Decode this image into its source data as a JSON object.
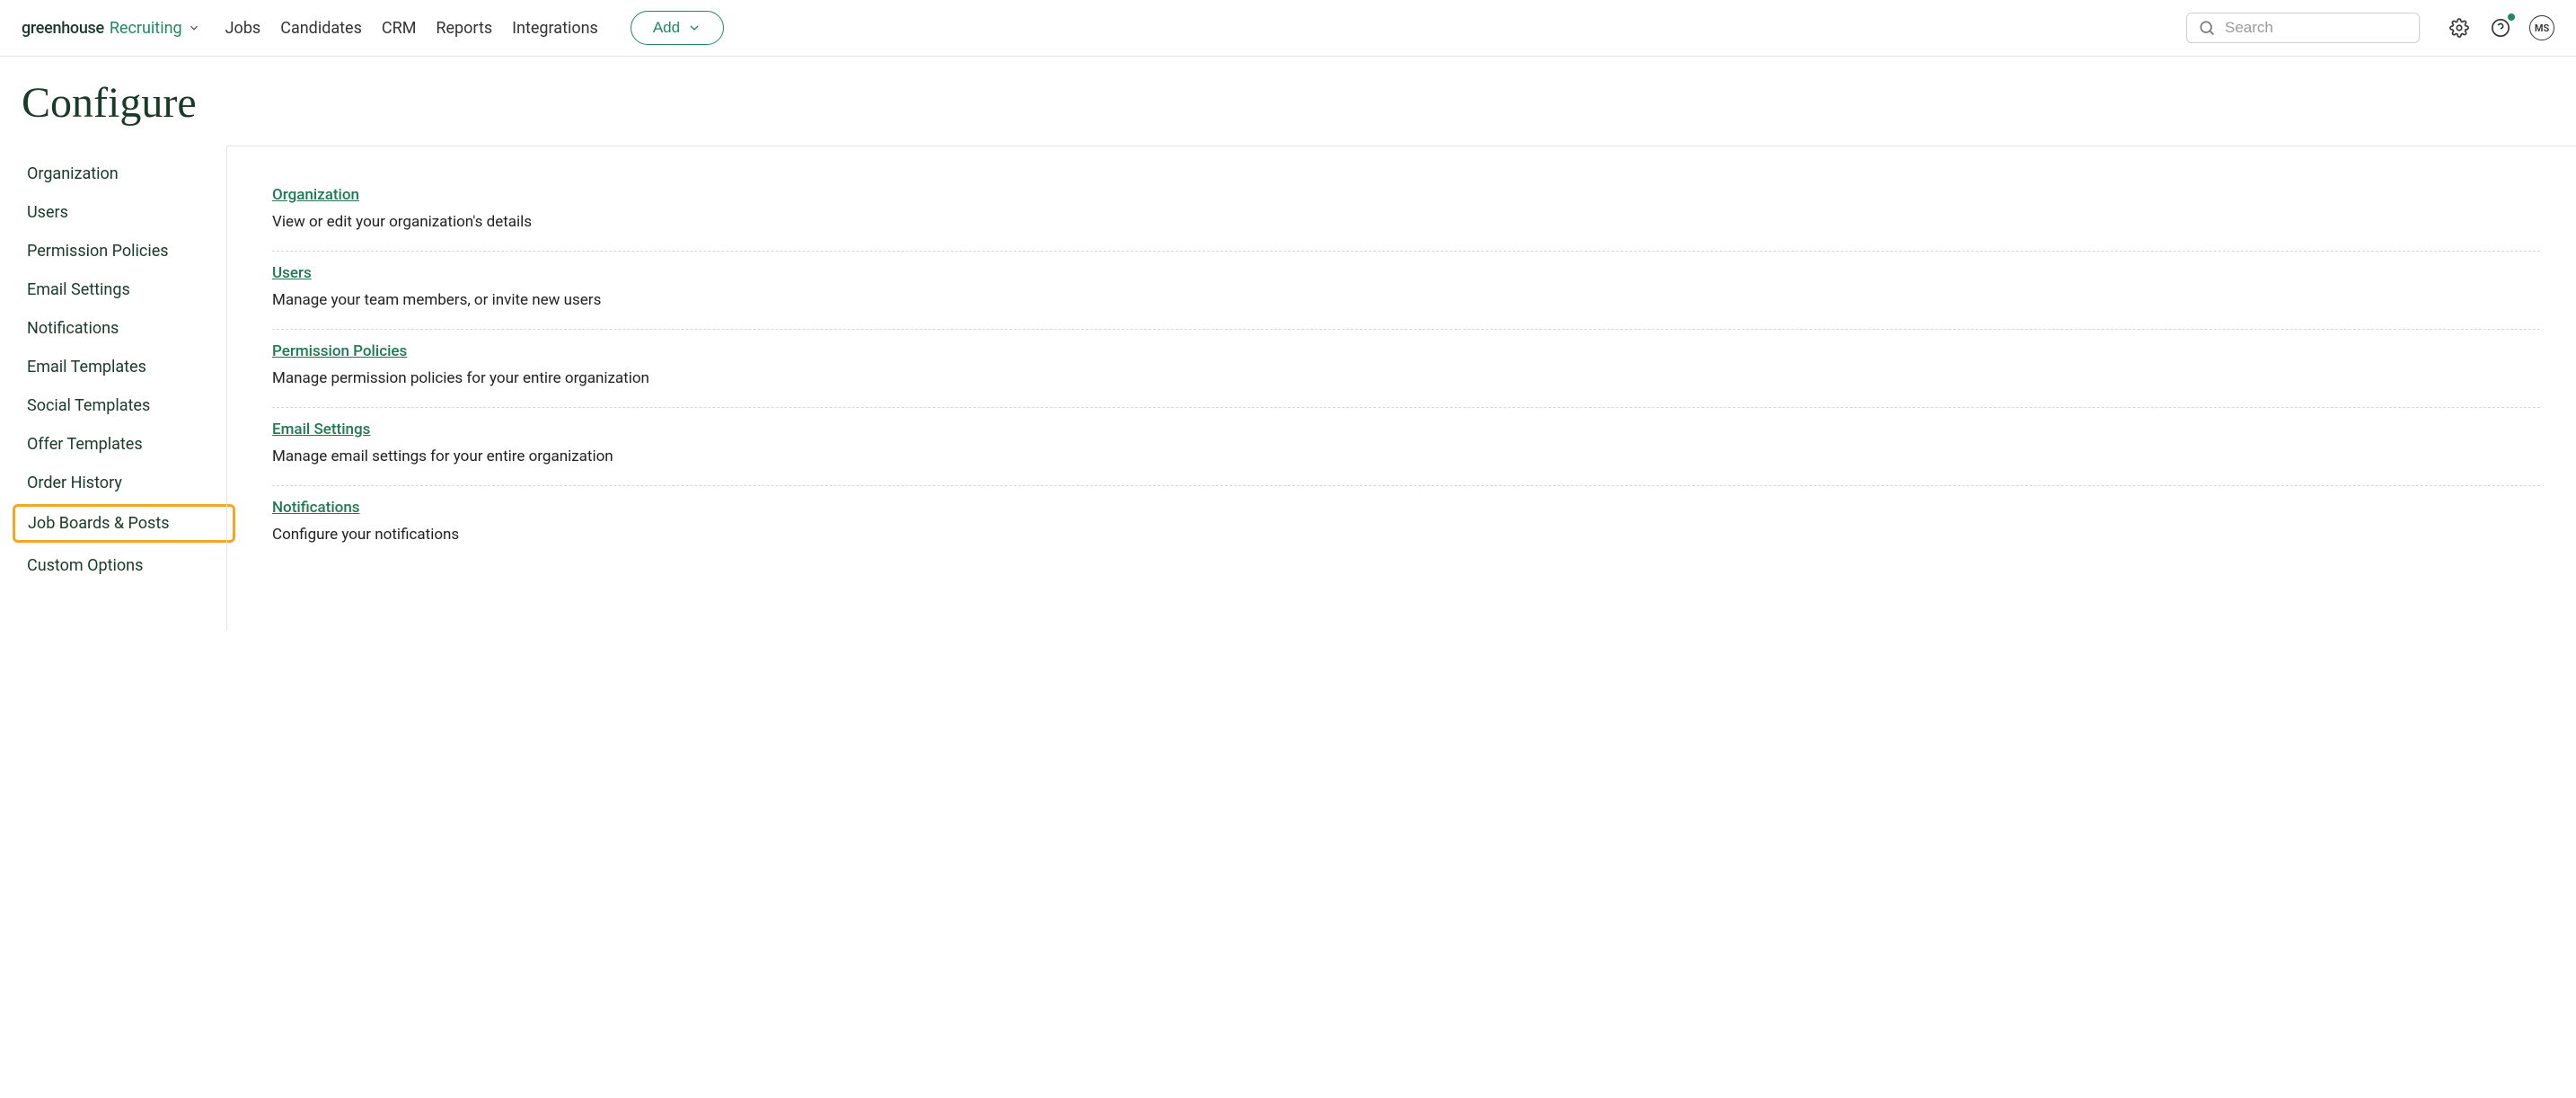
{
  "header": {
    "logo_primary": "greenhouse",
    "logo_secondary": "Recruiting",
    "nav": [
      "Jobs",
      "Candidates",
      "CRM",
      "Reports",
      "Integrations"
    ],
    "add_label": "Add",
    "search_placeholder": "Search",
    "avatar_initials": "MS"
  },
  "page": {
    "title": "Configure"
  },
  "sidebar": {
    "items": [
      {
        "label": "Organization",
        "highlight": false
      },
      {
        "label": "Users",
        "highlight": false
      },
      {
        "label": "Permission Policies",
        "highlight": false
      },
      {
        "label": "Email Settings",
        "highlight": false
      },
      {
        "label": "Notifications",
        "highlight": false
      },
      {
        "label": "Email Templates",
        "highlight": false
      },
      {
        "label": "Social Templates",
        "highlight": false
      },
      {
        "label": "Offer Templates",
        "highlight": false
      },
      {
        "label": "Order History",
        "highlight": false
      },
      {
        "label": "Job Boards & Posts",
        "highlight": true
      },
      {
        "label": "Custom Options",
        "highlight": false
      }
    ]
  },
  "sections": [
    {
      "title": "Organization",
      "desc": "View or edit your organization's details"
    },
    {
      "title": "Users",
      "desc": "Manage your team members, or invite new users"
    },
    {
      "title": "Permission Policies",
      "desc": "Manage permission policies for your entire organization"
    },
    {
      "title": "Email Settings",
      "desc": "Manage email settings for your entire organization"
    },
    {
      "title": "Notifications",
      "desc": "Configure your notifications"
    }
  ]
}
